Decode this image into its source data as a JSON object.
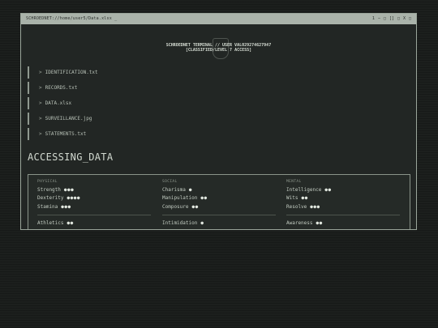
{
  "window": {
    "path": "SCHROEDNET://home/user5/Data.xlsx _",
    "controls": [
      "1",
      "−",
      "□",
      "[]",
      "□",
      "X",
      "□"
    ]
  },
  "header": {
    "line1": "SCHROEDNET TERMINAL // USER VAL029274627947",
    "line2": "[CLASSIFIED/LEVEL 7 ACCESS]"
  },
  "files": [
    {
      "chevron": ">",
      "name": "IDENTIFICATION.txt"
    },
    {
      "chevron": ">",
      "name": "RECORDS.txt"
    },
    {
      "chevron": ">",
      "name": "DATA.xlsx"
    },
    {
      "chevron": ">",
      "name": "SURVEILLANCE.jpg"
    },
    {
      "chevron": ">",
      "name": "STATEMENTS.txt"
    }
  ],
  "section_title": "ACCESSING_DATA",
  "attributes": {
    "physical": {
      "label": "PHYSICAL",
      "items": [
        {
          "name": "Strength",
          "dots": "●●●"
        },
        {
          "name": "Dexterity",
          "dots": "●●●●"
        },
        {
          "name": "Stamina",
          "dots": "●●●"
        }
      ],
      "skill": {
        "name": "Athletics",
        "dots": "●●"
      }
    },
    "social": {
      "label": "SOCIAL",
      "items": [
        {
          "name": "Charisma",
          "dots": "●"
        },
        {
          "name": "Manipulation",
          "dots": "●●"
        },
        {
          "name": "Composure",
          "dots": "●●"
        }
      ],
      "skill": {
        "name": "Intimidation",
        "dots": "●"
      }
    },
    "mental": {
      "label": "MENTAL",
      "items": [
        {
          "name": "Intelligence",
          "dots": "●●"
        },
        {
          "name": "Wits",
          "dots": "●●"
        },
        {
          "name": "Resolve",
          "dots": "●●●"
        }
      ],
      "skill": {
        "name": "Awareness",
        "dots": "●●"
      }
    }
  }
}
